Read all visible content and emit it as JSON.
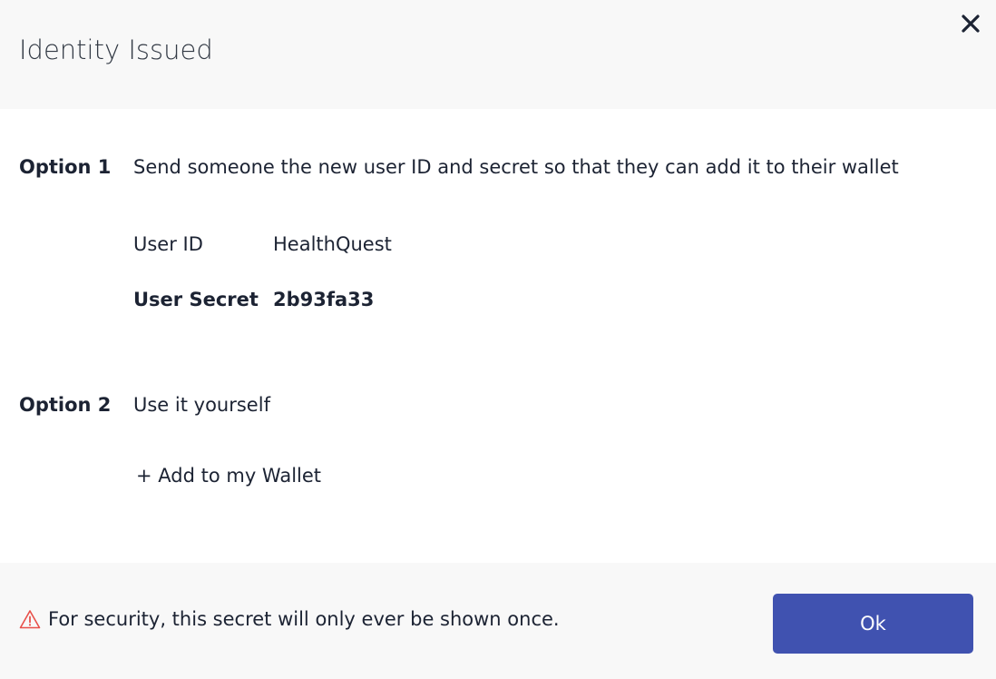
{
  "dialog": {
    "title": "Identity Issued",
    "close_icon": "close-icon"
  },
  "option1": {
    "label": "Option 1",
    "text": "Send someone the new user ID and secret so that they can add it to their wallet",
    "user_id_label": "User ID",
    "user_id_value": "HealthQuest",
    "user_secret_label": "User Secret",
    "user_secret_value": "2b93fa33"
  },
  "option2": {
    "label": "Option 2",
    "text": "Use it yourself",
    "add_wallet_label": "+ Add to my Wallet"
  },
  "footer": {
    "notice": "For security, this secret will only ever be shown once.",
    "warning_icon": "warning-icon",
    "ok_label": "Ok"
  },
  "colors": {
    "primary": "#4052b0",
    "warning": "#e8504a",
    "text": "#1c2333",
    "panel": "#f8f8f8"
  }
}
